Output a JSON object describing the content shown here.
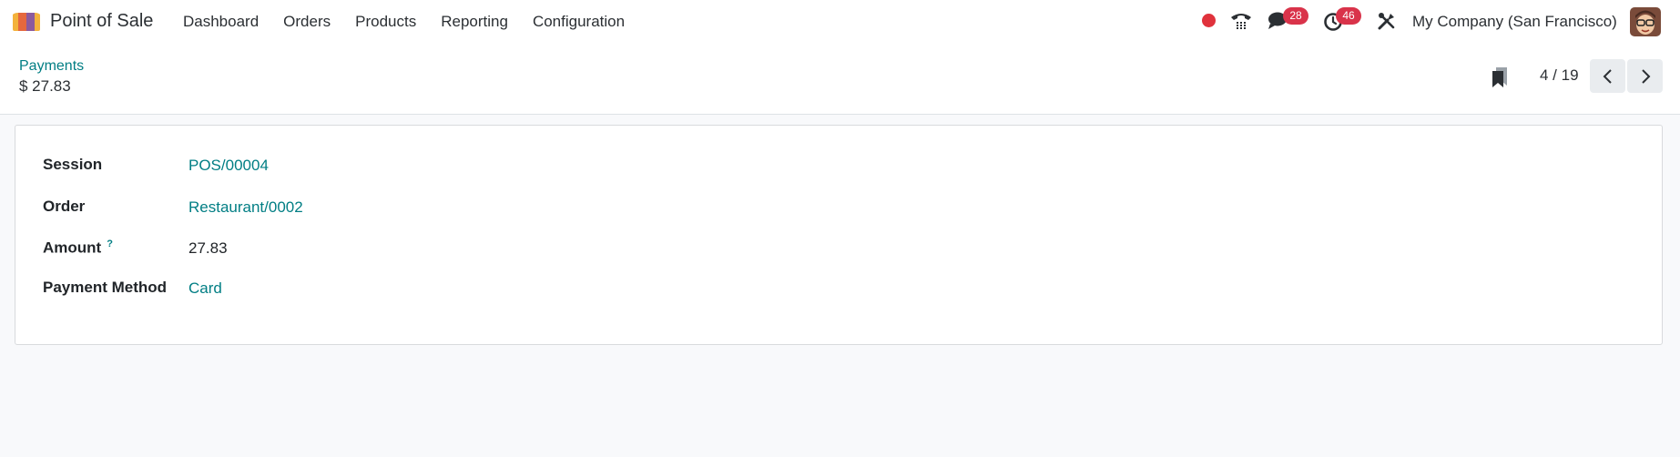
{
  "navbar": {
    "app_name": "Point of Sale",
    "menu": [
      "Dashboard",
      "Orders",
      "Products",
      "Reporting",
      "Configuration"
    ],
    "messages_count": "28",
    "activities_count": "46",
    "company": "My Company (San Francisco)",
    "icons": [
      "app-logo-icon",
      "recording-dot-icon",
      "phone-icon",
      "chat-icon",
      "clock-icon",
      "tools-icon",
      "avatar"
    ]
  },
  "breadcrumb": {
    "parent": "Payments",
    "current": "$ 27.83"
  },
  "pager": {
    "value": "4 / 19"
  },
  "form": {
    "session_label": "Session",
    "session_value": "POS/00004",
    "order_label": "Order",
    "order_value": "Restaurant/0002",
    "amount_label": "Amount",
    "amount_help": "?",
    "amount_value": "27.83",
    "method_label": "Payment Method",
    "method_value": "Card"
  },
  "colors": {
    "accent": "#017e84",
    "badge": "#d9334a",
    "recording": "#e0323c"
  }
}
